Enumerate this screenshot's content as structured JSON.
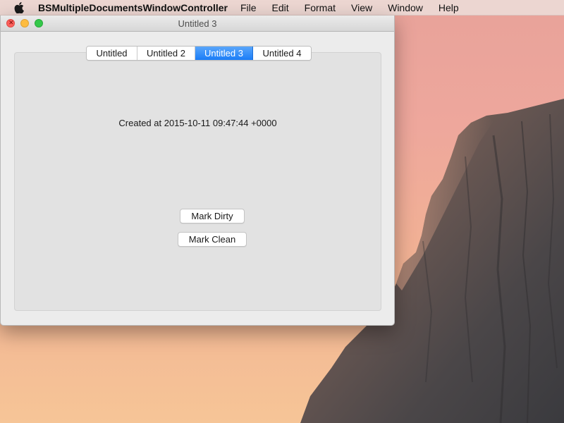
{
  "menubar": {
    "app_name": "BSMultipleDocumentsWindowController",
    "items": [
      "File",
      "Edit",
      "Format",
      "View",
      "Window",
      "Help"
    ]
  },
  "window": {
    "title": "Untitled 3",
    "tabs": [
      {
        "label": "Untitled",
        "selected": false
      },
      {
        "label": "Untitled 2",
        "selected": false
      },
      {
        "label": "Untitled 3",
        "selected": true
      },
      {
        "label": "Untitled 4",
        "selected": false
      }
    ],
    "created_text": "Created at 2015-10-11 09:47:44 +0000",
    "mark_dirty_label": "Mark Dirty",
    "mark_clean_label": "Mark Clean"
  },
  "colors": {
    "selected_tab": "#1a7df7",
    "close_button": "#fc605c",
    "minimize_button": "#fdbc40",
    "zoom_button": "#34c84a"
  }
}
